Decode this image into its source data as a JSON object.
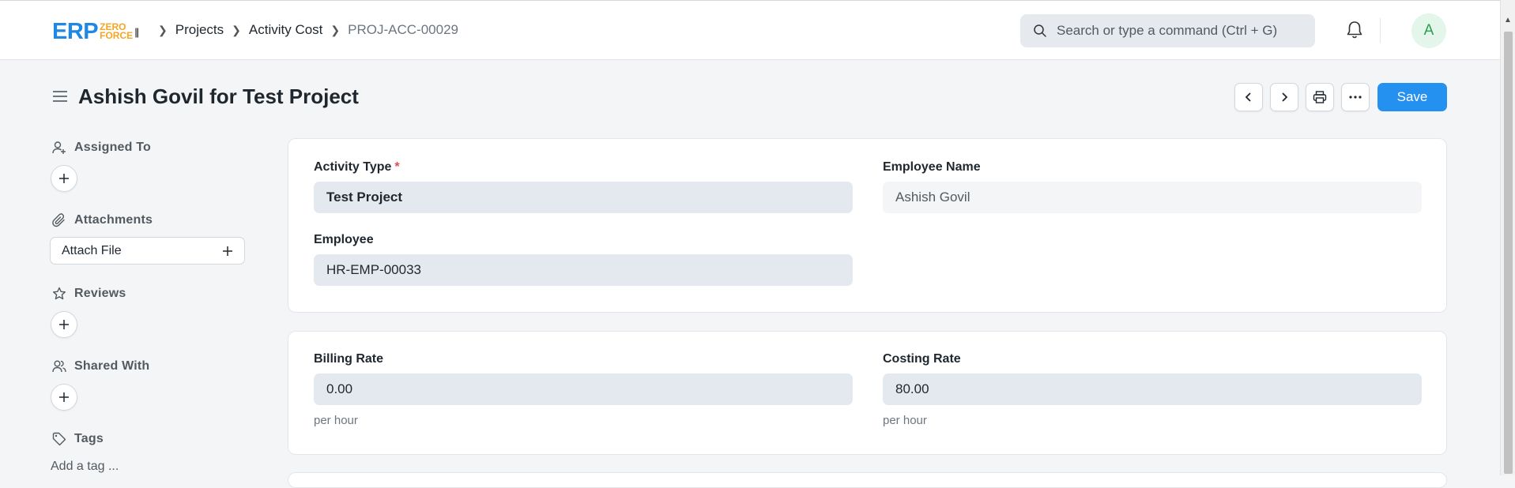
{
  "navbar": {
    "logo": {
      "main": "ERP",
      "top": "ZERO",
      "bottom": "FORCE"
    },
    "breadcrumbs": [
      "Projects",
      "Activity Cost",
      "PROJ-ACC-00029"
    ],
    "search_placeholder": "Search or type a command (Ctrl + G)",
    "avatar_initial": "A"
  },
  "page": {
    "title": "Ashish Govil for Test Project",
    "save_label": "Save"
  },
  "sidebar": {
    "assigned_to": "Assigned To",
    "attachments": "Attachments",
    "attach_file": "Attach File",
    "reviews": "Reviews",
    "shared_with": "Shared With",
    "tags": "Tags",
    "add_tag": "Add a tag ..."
  },
  "form": {
    "activity_type": {
      "label": "Activity Type",
      "required": "*",
      "value": "Test Project"
    },
    "employee_name": {
      "label": "Employee Name",
      "value": "Ashish Govil"
    },
    "employee": {
      "label": "Employee",
      "value": "HR-EMP-00033"
    },
    "billing_rate": {
      "label": "Billing Rate",
      "value": "0.00",
      "description": "per hour"
    },
    "costing_rate": {
      "label": "Costing Rate",
      "value": "80.00",
      "description": "per hour"
    }
  },
  "colors": {
    "primary": "#2490ef",
    "required": "#e24c4c",
    "avatar_bg": "#e4f5e9"
  }
}
